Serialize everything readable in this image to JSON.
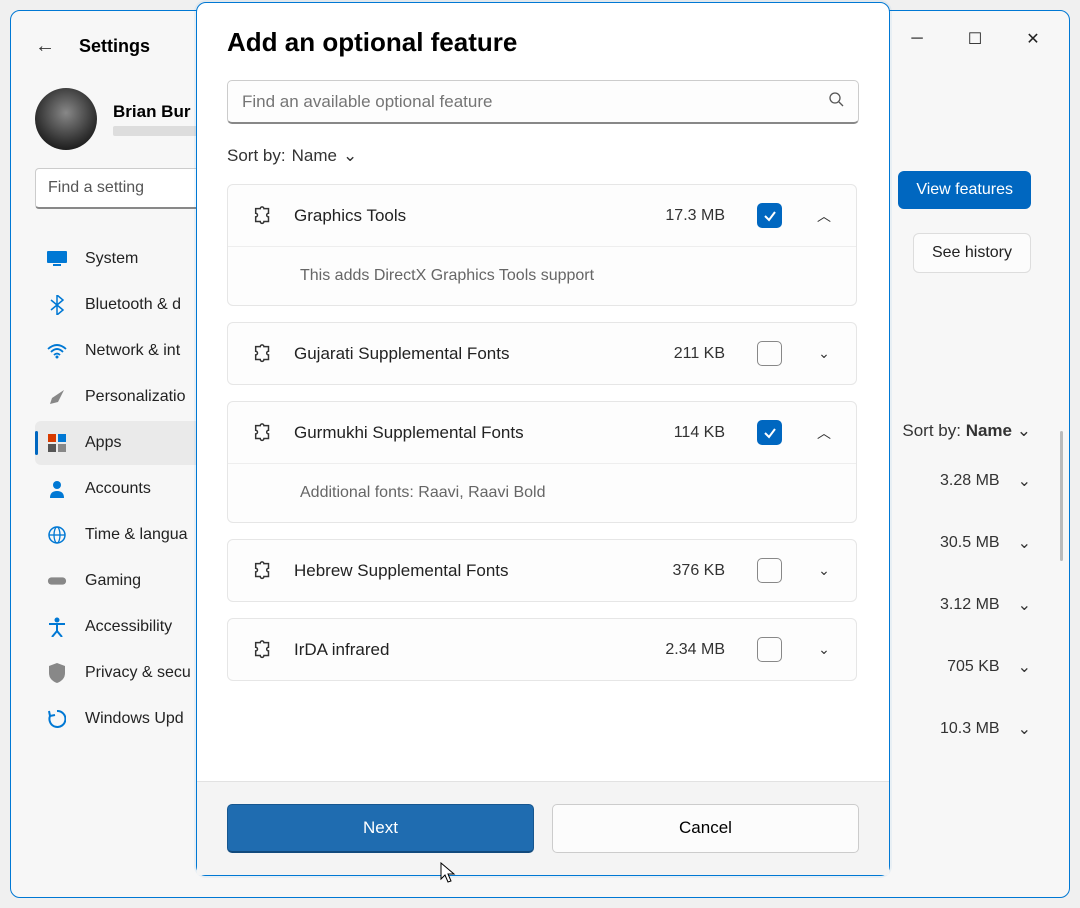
{
  "window": {
    "back_icon": "←",
    "title": "Settings",
    "user_name": "Brian Bur",
    "find_placeholder": "Find a setting",
    "nav": [
      {
        "label": "System",
        "icon": "monitor",
        "color": "#0078d4"
      },
      {
        "label": "Bluetooth & d",
        "icon": "bluetooth",
        "color": "#0078d4"
      },
      {
        "label": "Network & int",
        "icon": "wifi",
        "color": "#0078d4"
      },
      {
        "label": "Personalizatio",
        "icon": "brush",
        "color": "#666"
      },
      {
        "label": "Apps",
        "icon": "apps",
        "color": "#444",
        "active": true
      },
      {
        "label": "Accounts",
        "icon": "person",
        "color": "#0078d4"
      },
      {
        "label": "Time & langua",
        "icon": "globe",
        "color": "#0078d4"
      },
      {
        "label": "Gaming",
        "icon": "gamepad",
        "color": "#888"
      },
      {
        "label": "Accessibility",
        "icon": "accessibility",
        "color": "#0078d4"
      },
      {
        "label": "Privacy & secu",
        "icon": "shield",
        "color": "#777"
      },
      {
        "label": "Windows Upd",
        "icon": "update",
        "color": "#0078d4"
      }
    ],
    "view_features": "View features",
    "see_history": "See history",
    "sort_label": "Sort by:",
    "sort_value": "Name",
    "bg_rows": [
      {
        "size": "3.28 MB"
      },
      {
        "size": "30.5 MB"
      },
      {
        "size": "3.12 MB"
      },
      {
        "size": "705 KB"
      },
      {
        "size": "10.3 MB"
      }
    ]
  },
  "dialog": {
    "title": "Add an optional feature",
    "search_placeholder": "Find an available optional feature",
    "sort_label": "Sort by:",
    "sort_value": "Name",
    "features": [
      {
        "name": "Graphics Tools",
        "size": "17.3 MB",
        "checked": true,
        "expanded": true,
        "description": "This adds DirectX Graphics Tools support"
      },
      {
        "name": "Gujarati Supplemental Fonts",
        "size": "211 KB",
        "checked": false,
        "expanded": false
      },
      {
        "name": "Gurmukhi Supplemental Fonts",
        "size": "114 KB",
        "checked": true,
        "expanded": true,
        "description": "Additional fonts: Raavi, Raavi Bold"
      },
      {
        "name": "Hebrew Supplemental Fonts",
        "size": "376 KB",
        "checked": false,
        "expanded": false
      },
      {
        "name": "IrDA infrared",
        "size": "2.34 MB",
        "checked": false,
        "expanded": false
      }
    ],
    "next_label": "Next",
    "cancel_label": "Cancel"
  }
}
